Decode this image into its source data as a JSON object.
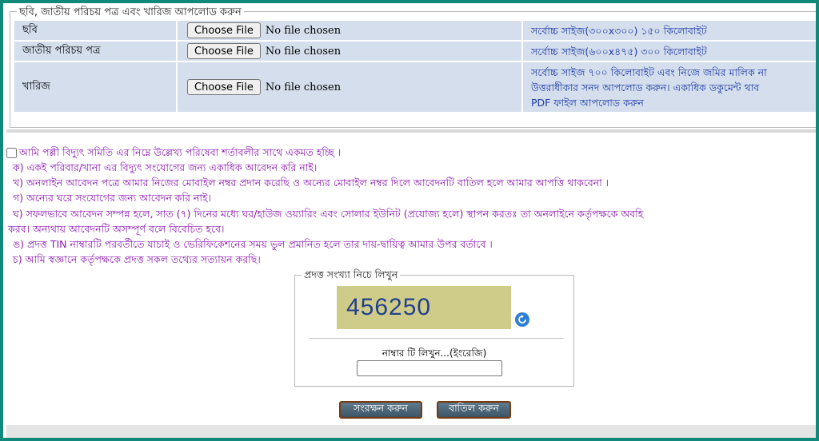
{
  "upload": {
    "legend": "ছবি, জাতীয় পরিচয় পত্র এবং খারিজ আপলোড করুন",
    "rows": [
      {
        "label": "ছবি",
        "button": "Choose File",
        "status": "No file chosen",
        "note": "সর্বোচ্চ সাইজ(৩০০x৩০০) ১৫০ কিলোবাইট"
      },
      {
        "label": "জাতীয় পরিচয় পত্র",
        "button": "Choose File",
        "status": "No file chosen",
        "note": "সর্বোচ্চ সাইজ(৬০০x৪৭৫) ৩০০ কিলোবাইট"
      },
      {
        "label": "খারিজ",
        "button": "Choose File",
        "status": "No file chosen",
        "note_lines": [
          "সর্বোচ্চ সাইজ ৭০০ কিলোবাইট এবং নিজে জমির মালিক না",
          "উত্তরাধীকার সনদ আপলোড করুন। একাধিক ডকুমেন্ট থাব",
          "PDF ফাইল আপলোড করুন"
        ]
      }
    ]
  },
  "terms": {
    "agree": "আমি পল্লী বিদ্যুৎ সমিতি এর নিম্নে উল্লেখ্য পরিষেবা শর্তাবলীর সাথে একমত হচ্ছি ।",
    "items": [
      "ক) একই পরিবার/খানা এর বিদ্যুৎ সংযোগের জন্য একাধিক আবেদন করি নাই।",
      "খ) অনলাইন আবেদন পত্রে আমার নিজের মোবাইল নম্বর প্রদান করেছি ও অন্যের মোবাইল নম্বর দিলে আবেদনটি বাতিল হলে আমার আপত্তি থাকবেনা ।",
      "গ) অন্যের ঘরে সংযোগের জন্য আবেদন করি নাই।",
      "ঘ) সফলভাবে আবেদন সম্পন্ন হলে, সাত (৭) দিনের মধ্যে ঘর/হাউজ ওয়্যারিং এবং সোলার ইউনিট (প্রযোজ্য হলে) স্থাপন করতঃ তা অনলাইনে কর্তৃপক্ষকে অবহি",
      "করব। অন্যথায় আবেদনটি অসম্পূর্ণ বলে বিবেচিত হবে।",
      "ঙ) প্রদত্ত TIN নাম্বারটি পরবর্তীতে যাচাই ও ভেরিফিকেশনের সময় ভুল প্রমানিত হলে তার দায়-দ্বায়িত্ব আমার উপর বর্তাবে ।",
      "চ) আমি স্বজ্ঞানে কর্তৃপক্ষকে প্রদত্ত সকল তথ্যের সত্যায়ন করছি।"
    ]
  },
  "captcha": {
    "legend": "প্রদত্ত সংখ্যা নিচে লিখুন",
    "code": "456250",
    "input_label": "নাম্বার টি লিখুন...(ইংরেজি)",
    "input_value": ""
  },
  "buttons": {
    "save": "সংরক্ষন করুন",
    "cancel": "বাতিল করুন"
  },
  "colors": {
    "border": "#10897a",
    "row_bg": "#d4deec",
    "note_text": "#1d3aa8",
    "terms_text": "#8b1ab2",
    "captcha_bg": "#cfcc8a"
  }
}
